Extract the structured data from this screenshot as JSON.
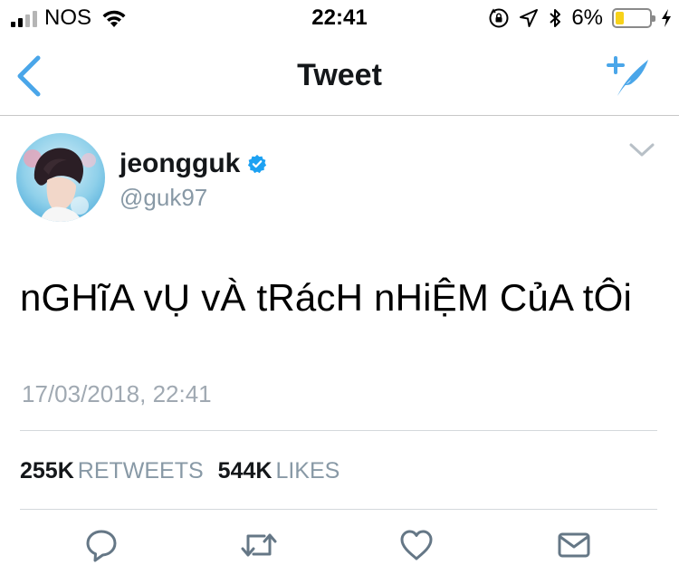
{
  "status_bar": {
    "carrier": "NOS",
    "time": "22:41",
    "battery_percent": "6%",
    "battery_level": 0.06,
    "signal_bars_filled": 2,
    "icons": [
      "wifi-icon",
      "orientation-lock-icon",
      "location-icon",
      "bluetooth-icon",
      "charging-icon"
    ],
    "battery_color": "#f7d21a"
  },
  "nav": {
    "title": "Tweet",
    "back_icon": "chevron-left-icon",
    "compose_icon": "compose-tweet-icon",
    "accent_color": "#4aa6e9"
  },
  "tweet": {
    "display_name": "jeongguk",
    "handle": "@guk97",
    "verified": true,
    "verified_color": "#1da1f2",
    "text": "nGHĩA vỤ vÀ tRácH nHiỆM CủA tÔi",
    "timestamp": "17/03/2018, 22:41",
    "stats": {
      "retweets_count": "255K",
      "retweets_label": "RETWEETS",
      "likes_count": "544K",
      "likes_label": "LIKES"
    }
  },
  "actions": [
    {
      "name": "reply-icon"
    },
    {
      "name": "retweet-icon"
    },
    {
      "name": "like-icon"
    },
    {
      "name": "direct-message-icon"
    }
  ]
}
